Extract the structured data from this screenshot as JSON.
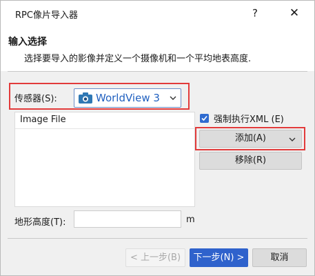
{
  "window": {
    "title": "RPC像片导入器",
    "help_label": "?",
    "close_label": "✕"
  },
  "header": {
    "section_title": "输入选择",
    "description": "选择要导入的影像并定义一个摄像机和一个平均地表高度."
  },
  "sensor": {
    "label": "传感器(S):",
    "selected": "WorldView 3",
    "icon": "camera-icon"
  },
  "image_list": {
    "column_header": "Image File",
    "rows": []
  },
  "options": {
    "force_xml_label": "强制执行XML (E)",
    "force_xml_checked": true
  },
  "buttons": {
    "add_label": "添加(A)",
    "remove_label": "移除(R)",
    "prev_label": "< 上一步(B)",
    "next_label": "下一步(N) >",
    "cancel_label": "取消"
  },
  "terrain": {
    "label": "地形高度(T):",
    "value": "",
    "unit": "m"
  },
  "colors": {
    "highlight": "#e23a3a",
    "primary": "#2f62cc",
    "dialog_bg": "#f0f0f0"
  }
}
